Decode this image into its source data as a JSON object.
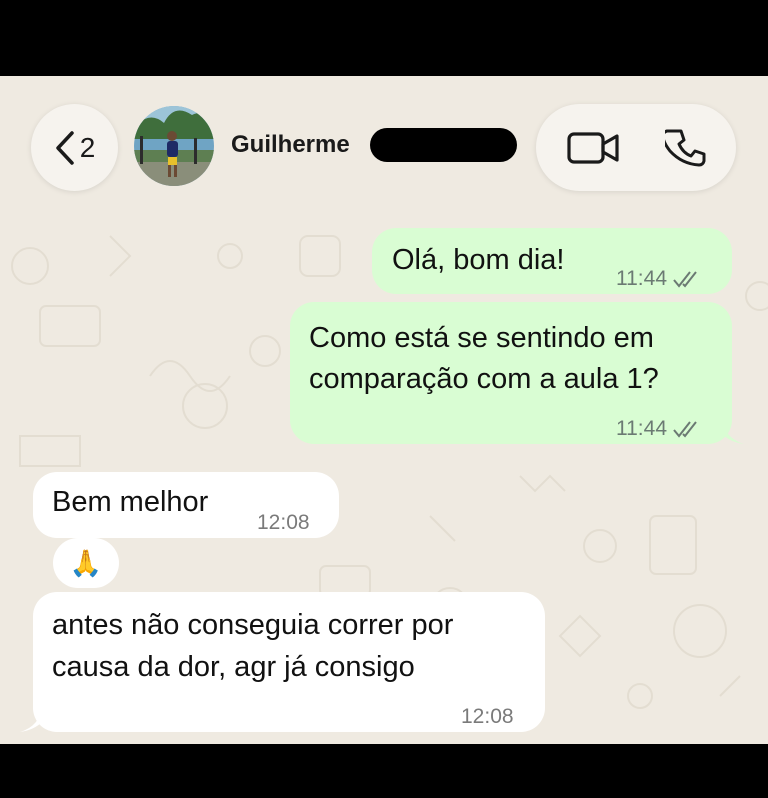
{
  "header": {
    "back_count": "2",
    "contact_name": "Guilherme"
  },
  "messages": [
    {
      "direction": "outgoing",
      "text": "Olá, bom dia!",
      "time": "11:44",
      "status": "read"
    },
    {
      "direction": "outgoing",
      "text_lines": [
        "Como está se sentindo em",
        "comparação com a aula 1?"
      ],
      "time": "11:44",
      "status": "read"
    },
    {
      "direction": "incoming",
      "text": "Bem melhor",
      "time": "12:08"
    },
    {
      "direction": "incoming",
      "reaction": "🙏"
    },
    {
      "direction": "incoming",
      "text_lines": [
        "antes não conseguia correr por",
        "causa da dor, agr já consigo"
      ],
      "time": "12:08"
    }
  ],
  "colors": {
    "chat_background": "#efeae1",
    "outgoing_bubble": "#d9fdd3",
    "incoming_bubble": "#ffffff",
    "read_ticks": "#6b7a73"
  },
  "icons": [
    "back-chevron-icon",
    "video-call-icon",
    "phone-call-icon",
    "double-check-icon"
  ]
}
